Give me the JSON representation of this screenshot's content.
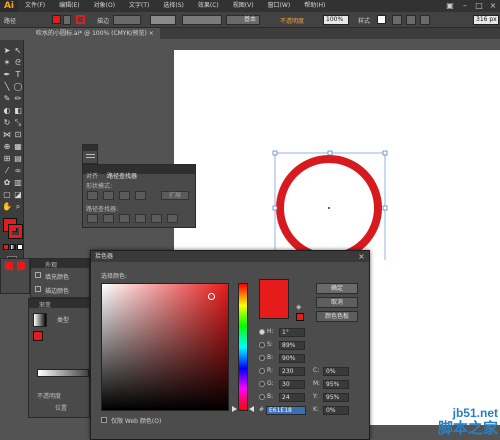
{
  "app": {
    "logo": "Ai"
  },
  "menu": [
    "文件(F)",
    "编辑(E)",
    "对象(O)",
    "文字(T)",
    "选择(S)",
    "效果(C)",
    "视图(V)",
    "窗口(W)",
    "帮助(H)"
  ],
  "control_bar": {
    "object_label": "路径",
    "stroke_label": "描边",
    "stroke_style": "基本",
    "opacity_label": "不透明度",
    "opacity_value": "100%",
    "style_label": "样式",
    "width_value": "316 px",
    "fill_color": "#e61b1b"
  },
  "document": {
    "tab_title": "吹水的小圆标.ai* @ 100% (CMYK/预览)"
  },
  "pathfinder_panel": {
    "tabs": [
      "对齐",
      "路径查找器"
    ],
    "shape_modes_label": "形状模式:",
    "expand_label": "扩展",
    "pathfinders_label": "路径查找器:"
  },
  "appearance_panel": {
    "tab": "外观",
    "items": [
      "填充颜色",
      "描边颜色"
    ]
  },
  "gradient_panel": {
    "tab": "渐变",
    "type_label": "类型",
    "opacity_label": "不透明度",
    "location_label": "位置"
  },
  "color_picker": {
    "title": "拾色器",
    "select_color_label": "选择颜色:",
    "ok": "确定",
    "cancel": "取消",
    "swatches": "颜色色板",
    "web_only_label": "仅限 Web 颜色(O)",
    "fields": {
      "H": {
        "label": "H:",
        "value": "1°"
      },
      "S": {
        "label": "S:",
        "value": "89%"
      },
      "B": {
        "label": "B:",
        "value": "90%"
      },
      "R": {
        "label": "R:",
        "value": "230"
      },
      "G": {
        "label": "G:",
        "value": "30"
      },
      "Bl": {
        "label": "B:",
        "value": "24"
      },
      "C": {
        "label": "C:",
        "value": "0%"
      },
      "M": {
        "label": "M:",
        "value": "95%"
      },
      "Y": {
        "label": "Y:",
        "value": "95%"
      },
      "K": {
        "label": "K:",
        "value": "0%"
      },
      "hex_label": "#",
      "hex": "E61E18"
    },
    "current_color": "#e61b1b"
  },
  "watermark": {
    "line1": "jb51.net",
    "line2": "脚本之家"
  }
}
